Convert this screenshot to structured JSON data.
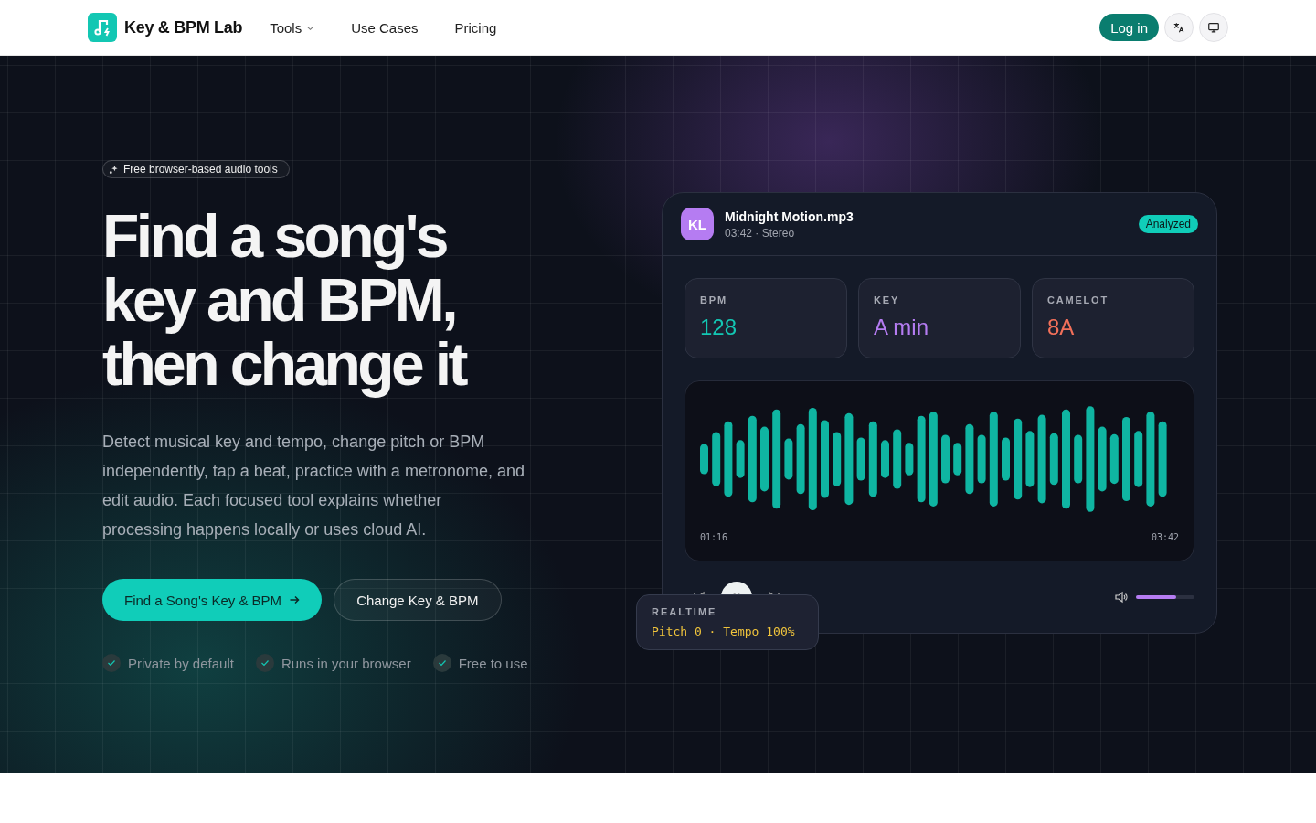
{
  "header": {
    "brand": "Key & BPM Lab",
    "nav": [
      {
        "label": "Tools",
        "kind": "dropdown"
      },
      {
        "label": "Use Cases",
        "kind": "link"
      },
      {
        "label": "Pricing",
        "kind": "link"
      }
    ],
    "login": "Log in"
  },
  "hero": {
    "badge": "Free browser-based audio tools",
    "title": "Find a song's key and BPM, then change it",
    "lead": "Detect musical key and tempo, change pitch or BPM independently, tap a beat, practice with a metronome, and edit audio. Each focused tool explains whether processing happens locally or uses cloud AI.",
    "buttons": [
      {
        "label": "Find a Song's Key & BPM",
        "kind": "primary"
      },
      {
        "label": "Change Key & BPM",
        "kind": "secondary"
      }
    ],
    "features": [
      "Private by default",
      "Runs in your browser",
      "Free to use"
    ]
  },
  "player": {
    "avatar": "KL",
    "file": "Midnight Motion.mp3",
    "meta": "03:42 · Stereo",
    "status": "Analyzed",
    "stats": [
      {
        "label": "BPM",
        "value": "128",
        "color": "#13c7b3"
      },
      {
        "label": "KEY",
        "value": "A min",
        "color": "#b57cf2"
      },
      {
        "label": "CAMELOT",
        "value": "8A",
        "color": "#f2705a"
      }
    ],
    "time_start": "01:16",
    "time_end": "03:42",
    "volume": {
      "level": 0.68
    },
    "realtime": {
      "label": "REALTIME",
      "value": "Pitch 0 · Tempo 100%"
    }
  }
}
